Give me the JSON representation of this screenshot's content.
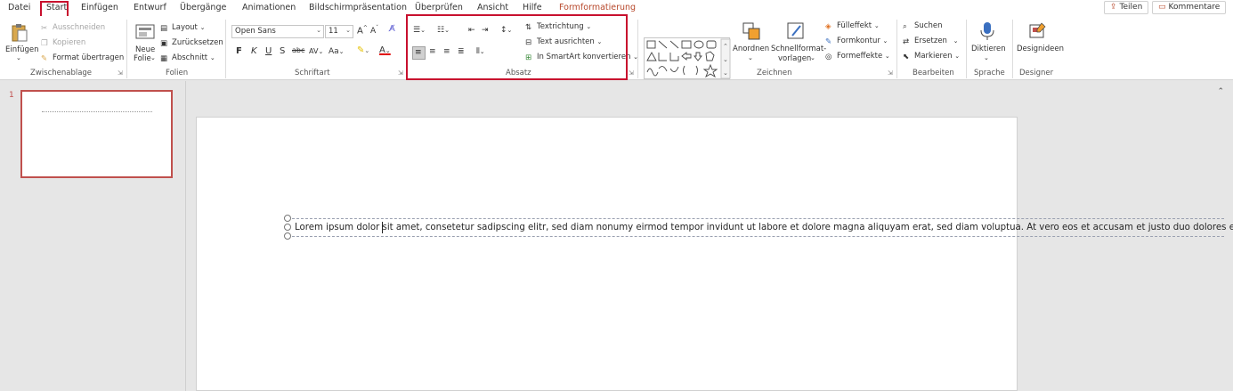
{
  "menu": {
    "tabs": [
      {
        "label": "Datei"
      },
      {
        "label": "Start"
      },
      {
        "label": "Einfügen"
      },
      {
        "label": "Entwurf"
      },
      {
        "label": "Übergänge"
      },
      {
        "label": "Animationen"
      },
      {
        "label": "Bildschirmpräsentation"
      },
      {
        "label": "Überprüfen"
      },
      {
        "label": "Ansicht"
      },
      {
        "label": "Hilfe"
      },
      {
        "label": "Formformatierung"
      }
    ],
    "share_label": "Teilen",
    "comments_label": "Kommentare"
  },
  "ribbon": {
    "clipboard": {
      "paste": "Einfügen",
      "cut": "Ausschneiden",
      "copy": "Kopieren",
      "format_painter": "Format übertragen",
      "label": "Zwischenablage"
    },
    "slides": {
      "new_slide_1": "Neue",
      "new_slide_2": "Folie",
      "layout": "Layout",
      "reset": "Zurücksetzen",
      "section": "Abschnitt",
      "label": "Folien"
    },
    "font": {
      "family": "Open Sans",
      "size": "11",
      "bold": "F",
      "italic": "K",
      "underline": "U",
      "strike": "S",
      "spacing": "AV",
      "case": "Aa",
      "label": "Schriftart"
    },
    "paragraph": {
      "text_direction": "Textrichtung",
      "align_text": "Text ausrichten",
      "smartart": "In SmartArt konvertieren",
      "label": "Absatz"
    },
    "drawing": {
      "arrange": "Anordnen",
      "quick_styles_1": "Schnellformat-",
      "quick_styles_2": "vorlagen",
      "fill": "Fülleffekt",
      "outline": "Formkontur",
      "effects": "Formeffekte",
      "label": "Zeichnen"
    },
    "editing": {
      "find": "Suchen",
      "replace": "Ersetzen",
      "select": "Markieren",
      "label": "Bearbeiten"
    },
    "voice": {
      "dictate": "Diktieren",
      "label": "Sprache"
    },
    "designer": {
      "ideas": "Designideen",
      "label": "Designer"
    }
  },
  "thumbnails": {
    "slide_number": "1"
  },
  "slide": {
    "text": "Lorem ipsum dolor sit amet, consetetur sadipscing elitr, sed diam nonumy eirmod tempor invidunt ut labore et dolore magna aliquyam erat, sed diam voluptua. At vero eos et accusam et justo duo dolores et ea re"
  },
  "colors": {
    "accent": "#b7472a",
    "highlight_box": "#c8102e",
    "thumb_border": "#c0504d"
  }
}
